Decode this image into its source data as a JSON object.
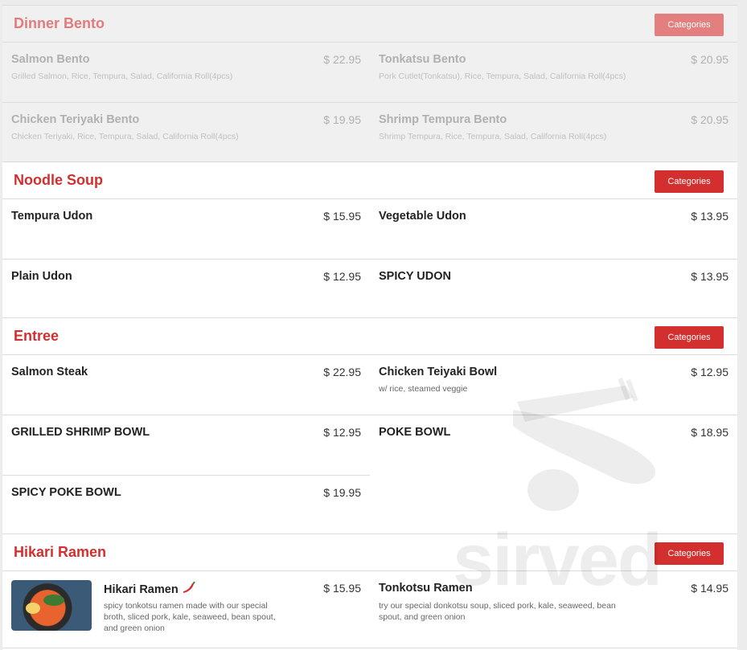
{
  "categories_label": "Categories",
  "watermark_text": "sirved",
  "sections": {
    "dinner_bento": {
      "title": "Dinner Bento",
      "items": [
        {
          "name": "Salmon Bento",
          "price": "$ 22.95",
          "desc": "Grilled Salmon, Rice, Tempura, Salad, California Roll(4pcs)"
        },
        {
          "name": "Tonkatsu Bento",
          "price": "$ 20.95",
          "desc": "Pork Cutlet(Tonkatsu), Rice, Tempura, Salad, California Roll(4pcs)"
        },
        {
          "name": "Chicken Teriyaki Bento",
          "price": "$ 19.95",
          "desc": "Chicken Teriyaki, Rice, Tempura, Salad, California Roll(4pcs)"
        },
        {
          "name": "Shrimp Tempura Bento",
          "price": "$ 20.95",
          "desc": "Shrimp Tempura, Rice, Tempura, Salad, California Roll(4pcs)"
        }
      ]
    },
    "noodle_soup": {
      "title": "Noodle Soup",
      "items": [
        {
          "name": "Tempura Udon",
          "price": "$ 15.95"
        },
        {
          "name": "Vegetable Udon",
          "price": "$ 13.95"
        },
        {
          "name": "Plain Udon",
          "price": "$ 12.95"
        },
        {
          "name": "SPICY UDON",
          "price": "$ 13.95"
        }
      ]
    },
    "entree": {
      "title": "Entree",
      "items": [
        {
          "name": "Salmon Steak",
          "price": "$ 22.95"
        },
        {
          "name": "Chicken Teiyaki Bowl",
          "price": "$ 12.95",
          "desc": "w/ rice, steamed veggie"
        },
        {
          "name": "GRILLED SHRIMP BOWL",
          "price": "$ 12.95"
        },
        {
          "name": "POKE BOWL",
          "price": "$ 18.95"
        },
        {
          "name": "SPICY POKE BOWL",
          "price": "$ 19.95"
        }
      ]
    },
    "hikari_ramen": {
      "title": "Hikari Ramen",
      "items": [
        {
          "name": "Hikari Ramen",
          "price": "$ 15.95",
          "desc": "spicy tonkotsu ramen made with our special broth, sliced pork, kale, seaweed, bean spout, and green onion",
          "icon": "chili-pepper-icon"
        },
        {
          "name": "Tonkotsu Ramen",
          "price": "$ 14.95",
          "desc": "try our special donkotsu soup, sliced pork, kale, seaweed, bean spout, and green onion"
        }
      ]
    }
  }
}
